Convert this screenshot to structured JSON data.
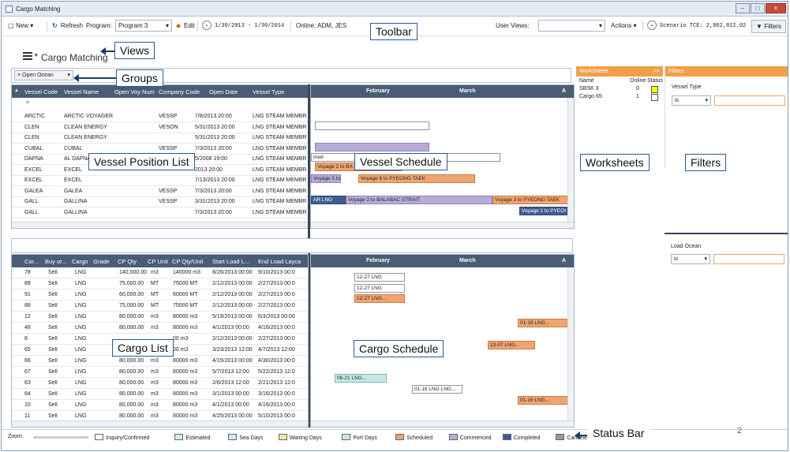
{
  "window": {
    "title": "Cargo Matching"
  },
  "toolbar": {
    "new_label": "New",
    "refresh_label": "Refresh",
    "program_label": "Program:",
    "program_value": "Program 3",
    "edit_label": "Edit",
    "date_range": "1/30/2013 - 1/30/2014",
    "online_label": "Online: ADM, JES",
    "user_views_label": "User Views:",
    "actions_label": "Actions",
    "scenario_tce": "Scenario TCE: 2,802,812.02",
    "filters_label": "Filters"
  },
  "views": {
    "title": "Cargo Matching"
  },
  "groups": {
    "chip_label": "Open Ocean"
  },
  "vessel_list": {
    "columns": [
      "Vessel Code",
      "Vessel Name",
      "Open Voy Num",
      "Company Code",
      "Open Date",
      "Vessel Type"
    ],
    "rows": [
      [
        "ARCTIC",
        "ARCTIC VOYAGER",
        "",
        "VESSP",
        "7/8/2013 20:00",
        "LNG STEAM MEMBRAN"
      ],
      [
        "CLEN",
        "CLEAN ENERGY",
        "",
        "VESON",
        "5/31/2013 20:00",
        "LNG STEAM MEMBRAN"
      ],
      [
        "CLEN",
        "CLEAN ENERGY",
        "",
        "",
        "5/31/2013 20:00",
        "LNG STEAM MEMBRAN"
      ],
      [
        "CUBAL",
        "CUBAL",
        "",
        "VESSP",
        "7/3/2013 20:00",
        "LNG STEAM MEMBRAN"
      ],
      [
        "DAFNA",
        "AL DAFNA",
        "",
        "",
        "5/2008 19:00",
        "LNG STEAM MEMBRAN"
      ],
      [
        "EXCEL",
        "EXCEL",
        "",
        "",
        "2013 20:00",
        "LNG STEAM MEMBRAN"
      ],
      [
        "EXCEL",
        "EXCEL",
        "",
        "",
        "7/13/2013 20:00",
        "LNG STEAM MEMBRAN"
      ],
      [
        "GALEA",
        "GALEA",
        "",
        "VESSP",
        "7/3/2013 20:00",
        "LNG STEAM MEMBRAN"
      ],
      [
        "GALL",
        "GALLINA",
        "",
        "VESSP",
        "3/31/2013 20:00",
        "LNG STEAM MEMBRAN"
      ],
      [
        "GALL",
        "GALLINA",
        "",
        "",
        "7/3/2013 20:00",
        "LNG STEAM MEMBRAN"
      ]
    ]
  },
  "vessel_schedule": {
    "months": [
      "February",
      "March",
      "A"
    ],
    "bars": [
      {
        "label": "med",
        "type": "inq"
      },
      {
        "label": "Voyage 2 to BA",
        "type": "sched"
      },
      {
        "label": "Voyage 5 to...",
        "type": "comm"
      },
      {
        "label": "Voyage 6 to PYEONG TAEK",
        "type": "sched"
      },
      {
        "label": "AR LNG",
        "type": "done"
      },
      {
        "label": "Voyage 2 to BALABAC STRAIT",
        "type": "comm"
      },
      {
        "label": "Voyage 3 to PYEONG TAEK",
        "type": "sched"
      },
      {
        "label": "Voyage 1 to PYEOI",
        "type": "done"
      }
    ]
  },
  "cargo_list": {
    "columns": [
      "Car...",
      "Buy or...",
      "Cargo",
      "Grade",
      "CP Qty",
      "CP Unit",
      "CP Qty/Unit",
      "Start Load L...",
      "End Load Layca"
    ],
    "rows": [
      [
        "78",
        "Sell",
        "LNG",
        "",
        "140,000.00",
        "m3",
        "140000 m3",
        "8/26/2013 00:00",
        "9/10/2013 00:0"
      ],
      [
        "89",
        "Sell",
        "LNG",
        "",
        "75,000.00",
        "MT",
        "75000 MT",
        "2/12/2013 00:00",
        "2/27/2013 00:0"
      ],
      [
        "91",
        "Sell",
        "LNG",
        "",
        "60,000.00",
        "MT",
        "60000 MT",
        "2/12/2013 00:00",
        "2/27/2013 00:0"
      ],
      [
        "88",
        "Sell",
        "LNG",
        "",
        "75,000.00",
        "MT",
        "75000 MT",
        "2/12/2013 00:00",
        "2/27/2013 00:0"
      ],
      [
        "12",
        "Sell",
        "LNG",
        "",
        "80,000.00",
        "m3",
        "80000 m3",
        "5/19/2013 00:00",
        "6/3/2013 00:00"
      ],
      [
        "48",
        "Sell",
        "LNG",
        "",
        "80,000.00",
        "m3",
        "80000 m3",
        "4/1/2013 00:00",
        "4/16/2013 00:0"
      ],
      [
        "8",
        "Sell",
        "LNG",
        "",
        "",
        "",
        "00 m3",
        "2/12/2013 00:00",
        "2/27/2013 00:0"
      ],
      [
        "65",
        "Sell",
        "LNG",
        "",
        "",
        "",
        "00 m3",
        "3/23/2013 12:00",
        "4/7/2013 12:00"
      ],
      [
        "66",
        "Sell",
        "LNG",
        "",
        "80,000.00",
        "m3",
        "80000 m3",
        "4/15/2013 00:00",
        "4/30/2013 00:0"
      ],
      [
        "67",
        "Sell",
        "LNG",
        "",
        "80,000.00",
        "m3",
        "80000 m3",
        "5/7/2013 12:00",
        "5/22/2013 12:0"
      ],
      [
        "63",
        "Sell",
        "LNG",
        "",
        "80,000.00",
        "m3",
        "80000 m3",
        "2/6/2013 12:00",
        "2/21/2013 12:0"
      ],
      [
        "64",
        "Sell",
        "LNG",
        "",
        "80,000.00",
        "m3",
        "80000 m3",
        "3/1/2013 00:00",
        "3/16/2013 00:0"
      ],
      [
        "10",
        "Sell",
        "LNG",
        "",
        "80,000.00",
        "m3",
        "80000 m3",
        "4/1/2013 00:00",
        "4/16/2013 00:0"
      ],
      [
        "11",
        "Sell",
        "LNG",
        "",
        "80,000.00",
        "m3",
        "80000 m3",
        "4/25/2013 00:00",
        "5/10/2013 00:0"
      ]
    ]
  },
  "cargo_schedule": {
    "months": [
      "February",
      "March",
      "A"
    ],
    "bars": [
      {
        "label": "12-27 LNG",
        "type": "inq"
      },
      {
        "label": "12-27 LNG",
        "type": "inq"
      },
      {
        "label": "12-27 LNG...",
        "type": "sched"
      },
      {
        "label": "01-16 LNG...",
        "type": "sched"
      },
      {
        "label": "23-07 LNG...",
        "type": "sched"
      },
      {
        "label": "06-21 LNG...",
        "type": "port"
      },
      {
        "label": "01-16 LNG LNG...",
        "type": "inq"
      },
      {
        "label": "01-16 LNG...",
        "type": "sched"
      }
    ]
  },
  "worksheets": {
    "title": "Worksheets",
    "col_name": "Name",
    "col_online": "Online",
    "col_status": "Status",
    "items": [
      {
        "name": "SBSK 3",
        "online": "0",
        "status_color": "#ffff00"
      },
      {
        "name": "Cargo 65",
        "online": "1",
        "status_color": "#ffffff"
      }
    ]
  },
  "filters": {
    "title": "Filters",
    "vessel_type_label": "Vessel Type",
    "vessel_type_op": "is",
    "load_ocean_label": "Load Ocean",
    "load_ocean_op": "is"
  },
  "status_bar": {
    "zoom_label": "Zoom:",
    "legend": [
      {
        "label": "Inquiry/Confirmed",
        "color": "#ffffff"
      },
      {
        "label": "Estimated",
        "color": "#d3ecf0"
      },
      {
        "label": "Sea Days",
        "color": "#cfe9f5"
      },
      {
        "label": "Waiting Days",
        "color": "#f5e9a8"
      },
      {
        "label": "Port Days",
        "color": "#c7e8e8"
      },
      {
        "label": "Scheduled",
        "color": "#f0a571"
      },
      {
        "label": "Commenced",
        "color": "#b8acd7"
      },
      {
        "label": "Completed",
        "color": "#3f5f93"
      },
      {
        "label": "Canceled/Withdrawn/Closed",
        "color": "#999999"
      }
    ]
  },
  "callouts": {
    "toolbar": "Toolbar",
    "views": "Views",
    "groups": "Groups",
    "vessel_position_list": "Vessel Position List",
    "vessel_schedule": "Vessel Schedule",
    "worksheets": "Worksheets",
    "filters": "Filters",
    "cargo_list": "Cargo List",
    "cargo_schedule": "Cargo Schedule",
    "status_bar": "Status Bar"
  },
  "page_number": "2"
}
